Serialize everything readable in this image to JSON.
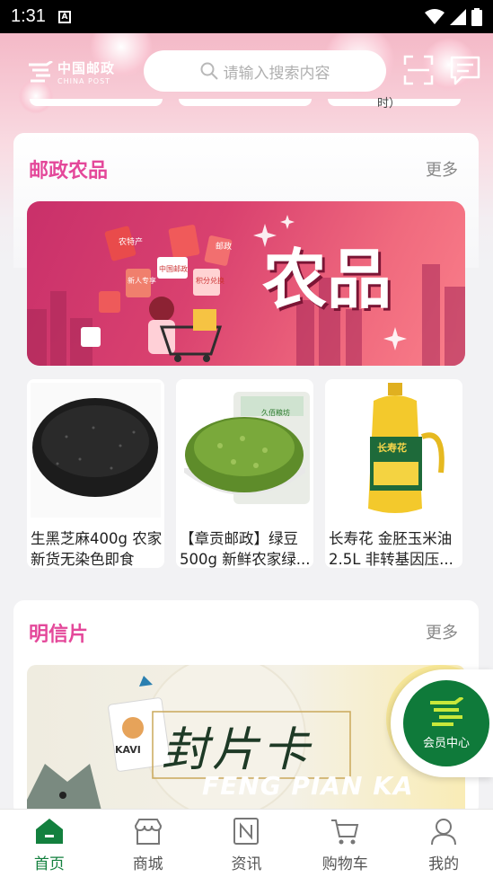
{
  "status_bar": {
    "time": "1:31",
    "sim_label": "A"
  },
  "header": {
    "logo_cn": "中国邮政",
    "logo_en": "CHINA POST",
    "search_placeholder": "请输入搜索内容",
    "prev_fragment": "时）"
  },
  "sections": {
    "agri": {
      "title": "邮政农品",
      "more": "更多",
      "banner_text": "农品",
      "banner_tags": [
        "农特产",
        "邮政",
        "中国邮政",
        "新人专享",
        "积分兑换"
      ],
      "products": [
        {
          "name": "生黑芝麻400g 农家新货无染色即食包..."
        },
        {
          "name": "【章贡邮政】绿豆500g 新鲜农家绿..."
        },
        {
          "name": "长寿花 金胚玉米油2.5L 非转基因压..."
        }
      ],
      "product_brand_labels": [
        "久佰粮坊",
        "长寿花"
      ]
    },
    "postcard": {
      "title": "明信片",
      "more": "更多",
      "banner_cn": "封片卡",
      "banner_en": "FENG PIAN KA",
      "banner_tag": "KAVI"
    }
  },
  "member_badge": {
    "label": "会员中心"
  },
  "tabbar": [
    {
      "label": "首页",
      "icon": "home-icon",
      "active": true
    },
    {
      "label": "商城",
      "icon": "store-icon",
      "active": false
    },
    {
      "label": "资讯",
      "icon": "news-icon",
      "active": false
    },
    {
      "label": "购物车",
      "icon": "cart-icon",
      "active": false
    },
    {
      "label": "我的",
      "icon": "user-icon",
      "active": false
    }
  ],
  "colors": {
    "accent_green": "#13803e",
    "section_pink": "#e4489a",
    "post_green": "#0f7a3a"
  }
}
